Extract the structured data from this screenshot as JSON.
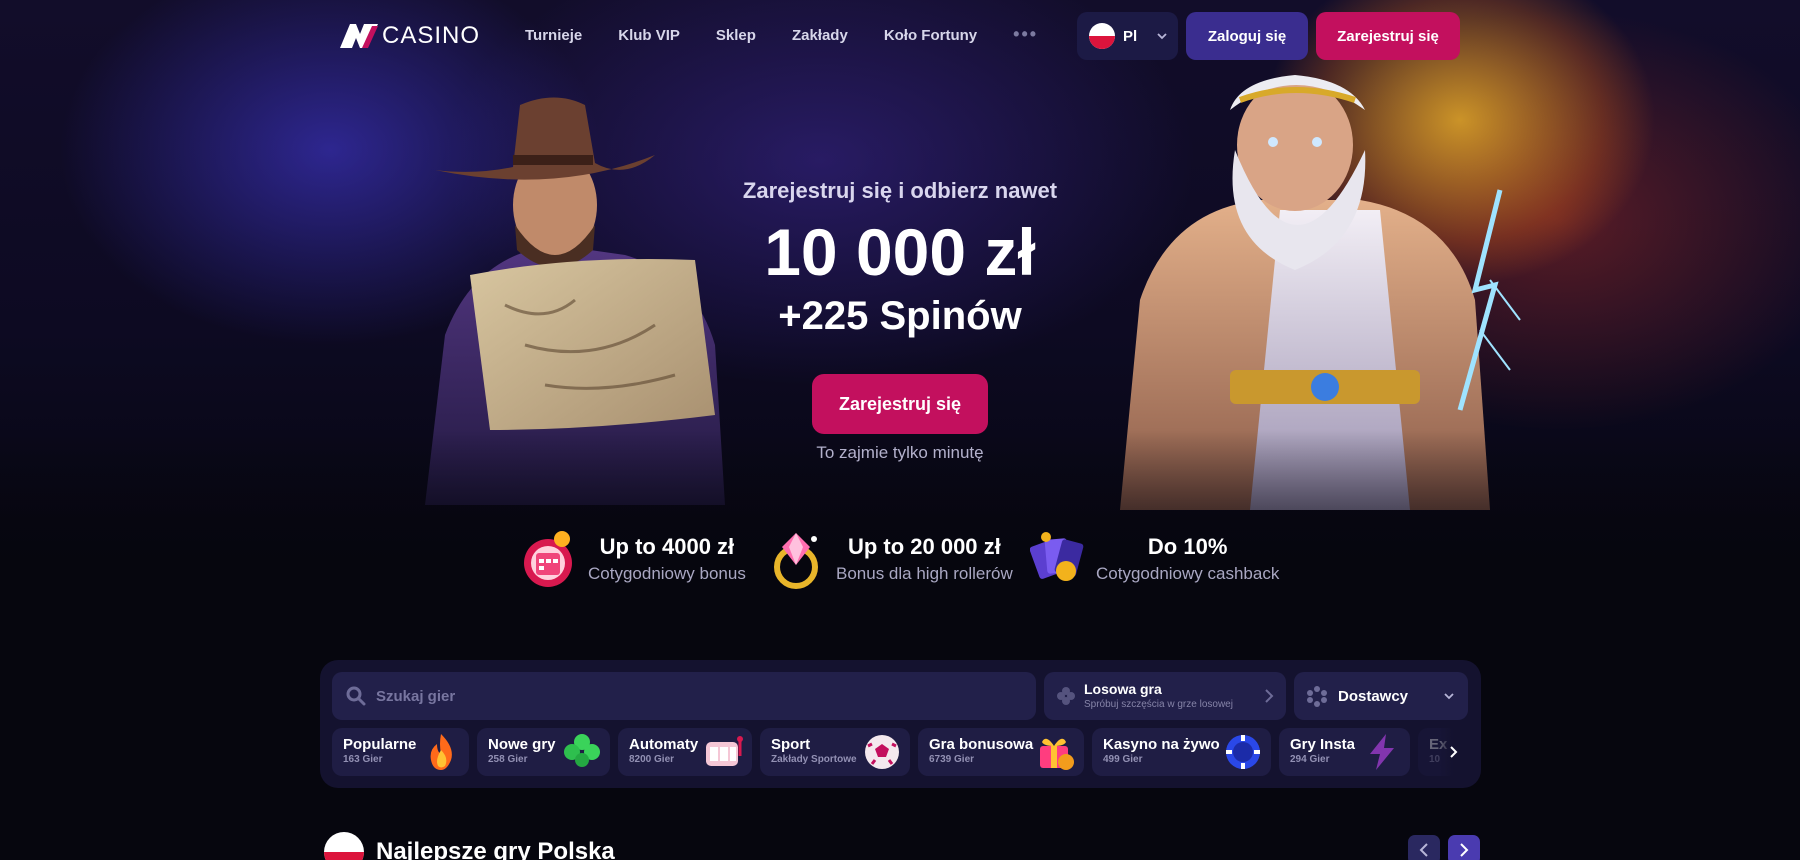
{
  "header": {
    "logo_text": "CASINO",
    "nav": [
      "Turnieje",
      "Klub VIP",
      "Sklep",
      "Zakłady",
      "Koło Fortuny"
    ],
    "more": "•••",
    "language": "Pl",
    "login_label": "Zaloguj się",
    "register_label": "Zarejestruj się"
  },
  "hero": {
    "subtitle": "Zarejestruj się i odbierz nawet",
    "amount": "10 000 zł",
    "spins": "+225 Spinów",
    "cta_label": "Zarejestruj się",
    "note": "To zajmie tylko minutę"
  },
  "perks": [
    {
      "title": "Up to 4000 zł",
      "subtitle": "Cotygodniowy bonus",
      "icon": "calendar-gift-icon"
    },
    {
      "title": "Up to 20 000 zł",
      "subtitle": "Bonus dla high rollerów",
      "icon": "diamond-ring-icon"
    },
    {
      "title": "Do 10%",
      "subtitle": "Cotygodniowy cashback",
      "icon": "cards-icon"
    }
  ],
  "games_panel": {
    "search_placeholder": "Szukaj gier",
    "random_title": "Losowa gra",
    "random_subtitle": "Spróbuj szczęścia w grze losowej",
    "providers_label": "Dostawcy",
    "categories": [
      {
        "title": "Popularne",
        "subtitle": "163 Gier",
        "icon": "fire-icon"
      },
      {
        "title": "Nowe gry",
        "subtitle": "258 Gier",
        "icon": "clover-icon"
      },
      {
        "title": "Automaty",
        "subtitle": "8200 Gier",
        "icon": "slot-machine-icon"
      },
      {
        "title": "Sport",
        "subtitle": "Zakłady Sportowe",
        "icon": "soccer-ball-icon"
      },
      {
        "title": "Gra bonusowa",
        "subtitle": "6739 Gier",
        "icon": "gift-icon"
      },
      {
        "title": "Kasyno na żywo",
        "subtitle": "499 Gier",
        "icon": "poker-chip-icon"
      },
      {
        "title": "Gry Insta",
        "subtitle": "294 Gier",
        "icon": "lightning-icon"
      },
      {
        "title": "Ex",
        "subtitle": "10",
        "icon": "more-icon"
      }
    ]
  },
  "best_games": {
    "title": "Najlepsze gry Polska"
  },
  "colors": {
    "accent_pink": "#c3105e",
    "accent_purple": "#3a2d8f",
    "panel_bg": "#14122f",
    "field_bg": "#22204a"
  }
}
